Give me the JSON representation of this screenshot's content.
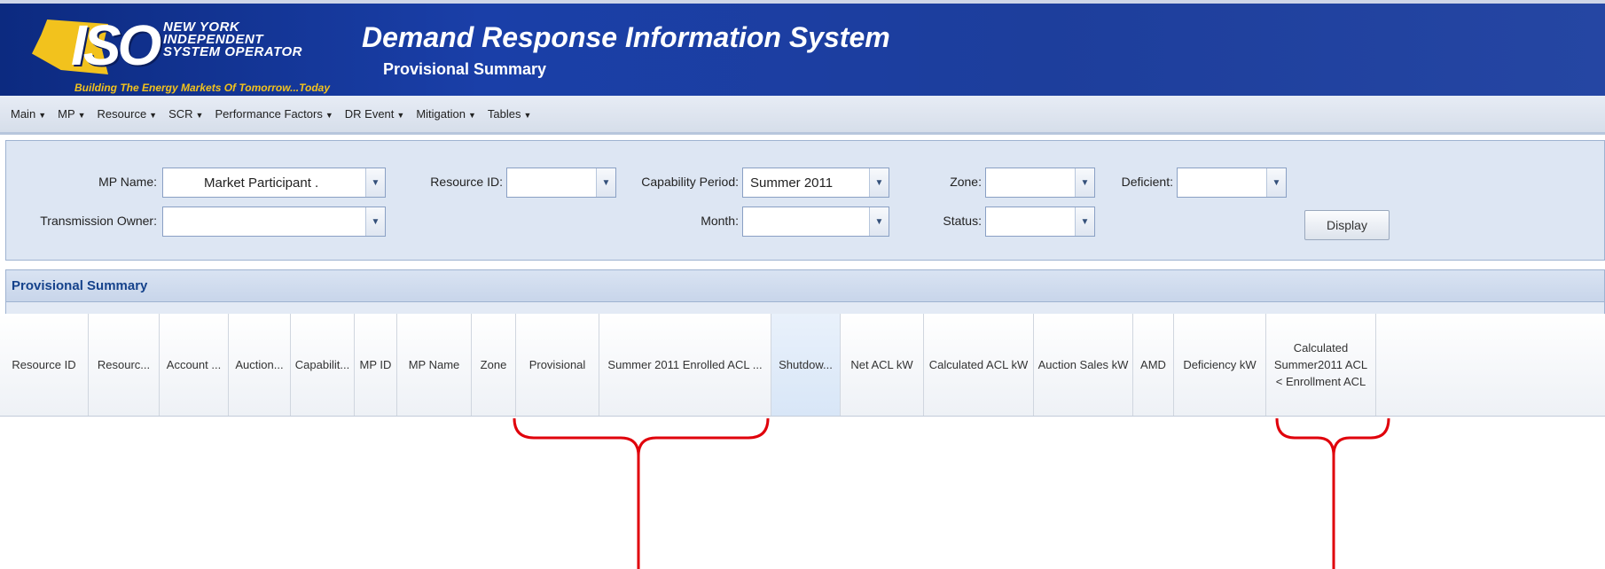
{
  "header": {
    "logo": {
      "mark": "ISO",
      "name_lines": [
        "NEW YORK",
        "INDEPENDENT",
        "SYSTEM OPERATOR"
      ],
      "tagline": "Building The Energy Markets Of Tomorrow...Today"
    },
    "app_title": "Demand Response Information System",
    "page_subtitle": "Provisional Summary"
  },
  "menu": [
    {
      "label": "Main"
    },
    {
      "label": "MP"
    },
    {
      "label": "Resource"
    },
    {
      "label": "SCR"
    },
    {
      "label": "Performance Factors"
    },
    {
      "label": "DR Event"
    },
    {
      "label": "Mitigation"
    },
    {
      "label": "Tables"
    }
  ],
  "filters": {
    "mp_name": {
      "label": "MP Name:",
      "value": "Market Participant ."
    },
    "transmission_owner": {
      "label": "Transmission Owner:",
      "value": ""
    },
    "resource_id": {
      "label": "Resource ID:",
      "value": ""
    },
    "capability_period": {
      "label": "Capability Period:",
      "value": "Summer 2011"
    },
    "month": {
      "label": "Month:",
      "value": ""
    },
    "zone": {
      "label": "Zone:",
      "value": ""
    },
    "status": {
      "label": "Status:",
      "value": ""
    },
    "deficient": {
      "label": "Deficient:",
      "value": ""
    },
    "display_label": "Display"
  },
  "summary": {
    "title": "Provisional Summary",
    "columns": [
      "Resource ID",
      "Resourc...",
      "Account ...",
      "Auction...",
      "Capabilit...",
      "MP ID",
      "MP Name",
      "Zone",
      "Provisional",
      "Summer 2011 Enrolled ACL ...",
      "Shutdow...",
      "Net ACL kW",
      "Calculated ACL kW",
      "Auction Sales kW",
      "AMD",
      "Deficiency kW"
    ],
    "last_column_lines": [
      "Calculated",
      "Summer2011 ACL",
      "< Enrollment ACL"
    ]
  },
  "colors": {
    "header_blue": "#1a3fa8",
    "logo_yellow": "#f2c21d",
    "annotation_red": "#e0000b",
    "panel_title": "#15428b"
  }
}
